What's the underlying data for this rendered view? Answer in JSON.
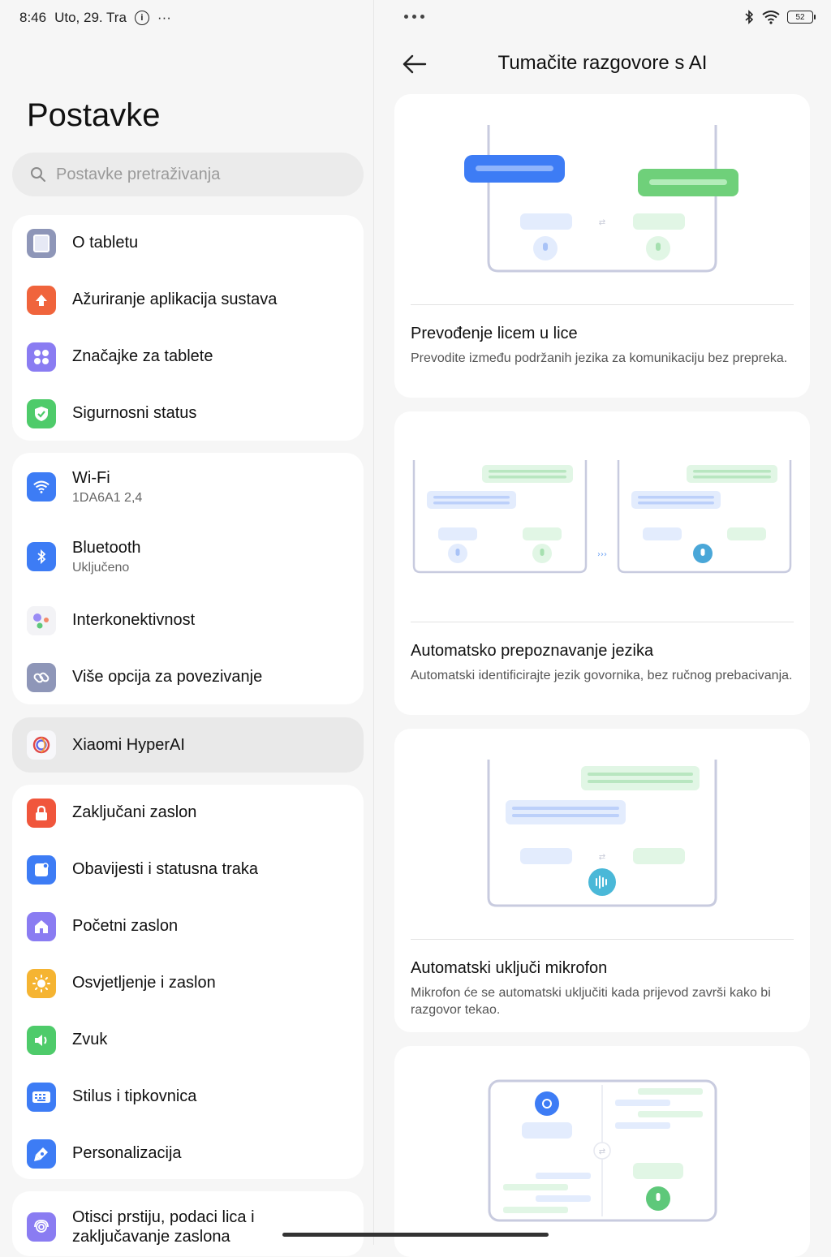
{
  "status_bar": {
    "time": "8:46",
    "date": "Uto, 29. Tra",
    "info_glyph": "i",
    "more": "···",
    "battery": "52"
  },
  "left": {
    "title": "Postavke",
    "search_placeholder": "Postavke pretraživanja",
    "groups": [
      {
        "items": [
          {
            "label": "O tabletu",
            "icon": "tablet-icon",
            "color": "#8e96b8"
          },
          {
            "label": "Ažuriranje aplikacija sustava",
            "icon": "update-arrow-icon",
            "color": "#f0643c"
          },
          {
            "label": "Značajke za tablete",
            "icon": "grid-dots-icon",
            "color": "#8a7cf2"
          },
          {
            "label": "Sigurnosni status",
            "icon": "shield-check-icon",
            "color": "#4ecb6a"
          }
        ]
      },
      {
        "items": [
          {
            "label": "Wi-Fi",
            "sub": "1DA6A1 2,4",
            "icon": "wifi-icon",
            "color": "#3d7cf5"
          },
          {
            "label": "Bluetooth",
            "sub": "Uključeno",
            "icon": "bluetooth-icon",
            "color": "#3d7cf5"
          },
          {
            "label": "Interkonektivnost",
            "icon": "interconnect-dots-icon",
            "color": "#ffffff"
          },
          {
            "label": "Više opcija za povezivanje",
            "icon": "link-icon",
            "color": "#8e96b8"
          }
        ]
      },
      {
        "items": [
          {
            "label": "Xiaomi HyperAI",
            "icon": "hyperai-icon",
            "color": "#ffffff"
          }
        ]
      },
      {
        "items": [
          {
            "label": "Zaključani zaslon",
            "icon": "lock-icon",
            "color": "#f0563c"
          },
          {
            "label": "Obavijesti i statusna traka",
            "icon": "notification-icon",
            "color": "#3d7cf5"
          },
          {
            "label": "Početni zaslon",
            "icon": "home-icon",
            "color": "#8a7cf2"
          },
          {
            "label": "Osvjetljenje i zaslon",
            "icon": "sun-icon",
            "color": "#f5b432"
          },
          {
            "label": "Zvuk",
            "icon": "speaker-icon",
            "color": "#4ecb6a"
          },
          {
            "label": "Stilus i tipkovnica",
            "icon": "keyboard-icon",
            "color": "#3d7cf5"
          },
          {
            "label": "Personalizacija",
            "icon": "brush-icon",
            "color": "#3d7cf5"
          }
        ]
      },
      {
        "items": [
          {
            "label": "Otisci prstiju, podaci lica i zaključavanje zaslona",
            "icon": "fingerprint-icon",
            "color": "#8a7cf2"
          }
        ]
      }
    ]
  },
  "right": {
    "title": "Tumačite razgovore s AI",
    "cards": [
      {
        "title": "Prevođenje licem u lice",
        "desc": "Prevodite između podržanih jezika za komunikaciju bez prepreka."
      },
      {
        "title": "Automatsko prepoznavanje jezika",
        "desc": "Automatski identificirajte jezik govornika, bez ručnog prebacivanja."
      },
      {
        "title": "Automatski uključi mikrofon",
        "desc": "Mikrofon će se automatski uključiti kada prijevod završi kako bi razgovor tekao."
      }
    ]
  }
}
